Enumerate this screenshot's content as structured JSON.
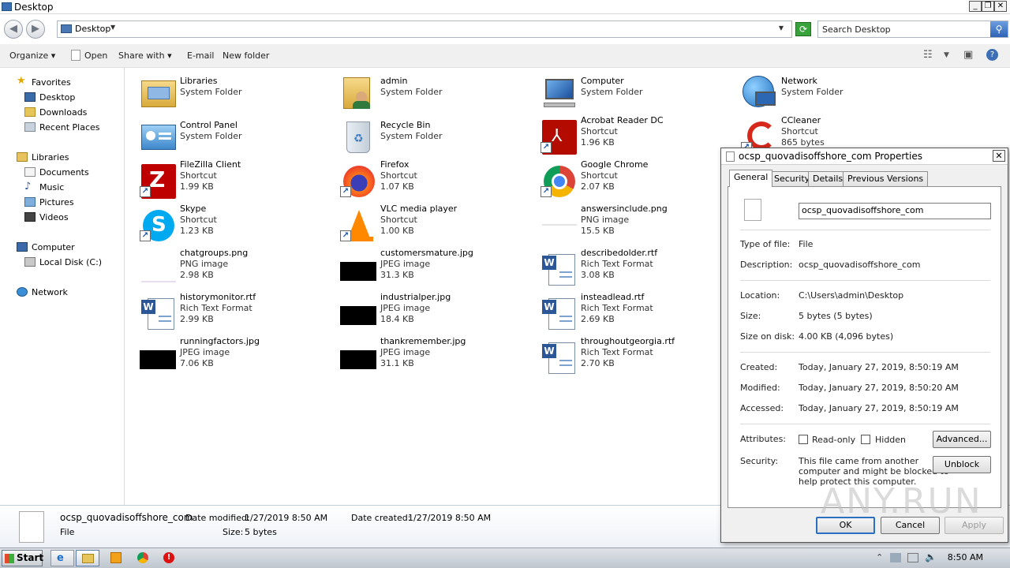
{
  "window": {
    "title": "Desktop"
  },
  "address": {
    "location": "Desktop",
    "search_placeholder": "Search Desktop"
  },
  "toolbar": {
    "organize": "Organize",
    "open": "Open",
    "share_with": "Share with",
    "email": "E-mail",
    "new_folder": "New folder"
  },
  "nav": {
    "favorites": "Favorites",
    "desktop": "Desktop",
    "downloads": "Downloads",
    "recent_places": "Recent Places",
    "libraries": "Libraries",
    "documents": "Documents",
    "music": "Music",
    "pictures": "Pictures",
    "videos": "Videos",
    "computer": "Computer",
    "local_disk": "Local Disk (C:)",
    "network": "Network"
  },
  "files": [
    {
      "name": "Libraries",
      "line2": "System Folder",
      "line3": ""
    },
    {
      "name": "admin",
      "line2": "System Folder",
      "line3": ""
    },
    {
      "name": "Computer",
      "line2": "System Folder",
      "line3": ""
    },
    {
      "name": "Network",
      "line2": "System Folder",
      "line3": ""
    },
    {
      "name": "Control Panel",
      "line2": "System Folder",
      "line3": ""
    },
    {
      "name": "Recycle Bin",
      "line2": "System Folder",
      "line3": ""
    },
    {
      "name": "Acrobat Reader DC",
      "line2": "Shortcut",
      "line3": "1.96 KB"
    },
    {
      "name": "CCleaner",
      "line2": "Shortcut",
      "line3": "865 bytes"
    },
    {
      "name": "FileZilla Client",
      "line2": "Shortcut",
      "line3": "1.99 KB"
    },
    {
      "name": "Firefox",
      "line2": "Shortcut",
      "line3": "1.07 KB"
    },
    {
      "name": "Google Chrome",
      "line2": "Shortcut",
      "line3": "2.07 KB"
    },
    {
      "name": "Skype",
      "line2": "Shortcut",
      "line3": "1.23 KB"
    },
    {
      "name": "VLC media player",
      "line2": "Shortcut",
      "line3": "1.00 KB"
    },
    {
      "name": "answersinclude.png",
      "line2": "PNG image",
      "line3": "15.5 KB"
    },
    {
      "name": "chatgroups.png",
      "line2": "PNG image",
      "line3": "2.98 KB"
    },
    {
      "name": "customersmature.jpg",
      "line2": "JPEG image",
      "line3": "31.3 KB"
    },
    {
      "name": "describedolder.rtf",
      "line2": "Rich Text Format",
      "line3": "3.08 KB"
    },
    {
      "name": "historymonitor.rtf",
      "line2": "Rich Text Format",
      "line3": "2.99 KB"
    },
    {
      "name": "industrialper.jpg",
      "line2": "JPEG image",
      "line3": "18.4 KB"
    },
    {
      "name": "insteadlead.rtf",
      "line2": "Rich Text Format",
      "line3": "2.69 KB"
    },
    {
      "name": "runningfactors.jpg",
      "line2": "JPEG image",
      "line3": "7.06 KB"
    },
    {
      "name": "thankremember.jpg",
      "line2": "JPEG image",
      "line3": "31.1 KB"
    },
    {
      "name": "throughoutgeorgia.rtf",
      "line2": "Rich Text Format",
      "line3": "2.70 KB"
    }
  ],
  "details_pane": {
    "filename": "ocsp_quovadisoffshore_com",
    "type": "File",
    "date_modified_label": "Date modified:",
    "date_modified": "1/27/2019 8:50 AM",
    "date_created_label": "Date created:",
    "date_created": "1/27/2019 8:50 AM",
    "size_label": "Size:",
    "size": "5 bytes"
  },
  "dialog": {
    "title": "ocsp_quovadisoffshore_com Properties",
    "tabs": [
      "General",
      "Security",
      "Details",
      "Previous Versions"
    ],
    "name_value": "ocsp_quovadisoffshore_com",
    "type_label": "Type of file:",
    "type_value": "File",
    "desc_label": "Description:",
    "desc_value": "ocsp_quovadisoffshore_com",
    "location_label": "Location:",
    "location_value": "C:\\Users\\admin\\Desktop",
    "size_label": "Size:",
    "size_value": "5 bytes (5 bytes)",
    "size_disk_label": "Size on disk:",
    "size_disk_value": "4.00 KB (4,096 bytes)",
    "created_label": "Created:",
    "created_value": "Today, January 27, 2019, 8:50:19 AM",
    "modified_label": "Modified:",
    "modified_value": "Today, January 27, 2019, 8:50:20 AM",
    "accessed_label": "Accessed:",
    "accessed_value": "Today, January 27, 2019, 8:50:19 AM",
    "attributes_label": "Attributes:",
    "readonly_label": "Read-only",
    "hidden_label": "Hidden",
    "advanced_label": "Advanced...",
    "security_label": "Security:",
    "security_text_1": "This file came from another",
    "security_text_2": "computer and might be blocked to",
    "security_text_3": "help protect this computer.",
    "unblock_label": "Unblock",
    "ok_label": "OK",
    "cancel_label": "Cancel",
    "apply_label": "Apply"
  },
  "taskbar": {
    "start_label": "Start",
    "clock": "8:50 AM"
  },
  "watermark": "ANY.RUN"
}
